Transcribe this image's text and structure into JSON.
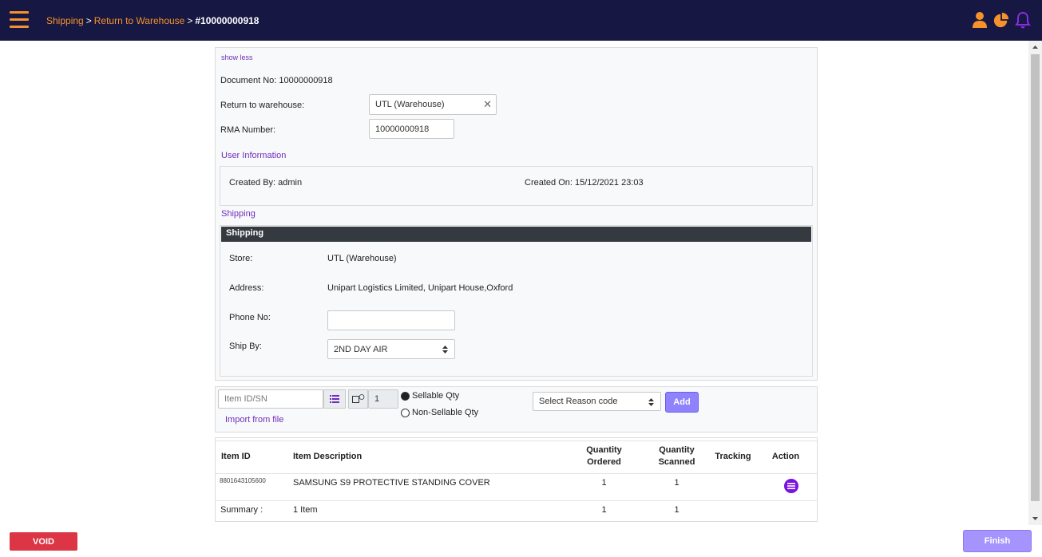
{
  "header": {
    "breadcrumb": {
      "level1": "Shipping",
      "sep1": ">",
      "level2": "Return to Warehouse",
      "sep2": ">",
      "current": "#10000000918"
    },
    "icons": [
      "hamburger-menu-icon",
      "user-icon",
      "pie-chart-icon",
      "bell-icon"
    ],
    "colors": {
      "bar": "#161743",
      "accent": "#f7922a",
      "bell": "#8b2be2"
    }
  },
  "details": {
    "show_less": "show less",
    "document_no": "Document No: 10000000918",
    "return_label": "Return to warehouse:",
    "return_value": "UTL (Warehouse)",
    "clear_glyph": "✕",
    "rma_label": "RMA Number:",
    "rma_value": "10000000918"
  },
  "user_info": {
    "section_title": "User Information",
    "created_by": "Created By: admin",
    "created_on": "Created On: 15/12/2021 23:03"
  },
  "shipping": {
    "section_title": "Shipping",
    "header": "Shipping",
    "store_label": "Store:",
    "store_value": "UTL (Warehouse)",
    "address_label": "Address:",
    "address_value": "Unipart Logistics Limited, Unipart House,Oxford",
    "phone_label": "Phone No:",
    "phone_value": "",
    "shipby_label": "Ship By:",
    "shipby_value": "2ND DAY AIR"
  },
  "add_item": {
    "item_placeholder": "Item ID/SN",
    "qty_value": "1",
    "import_link": "Import from file",
    "sellable": "Sellable Qty",
    "non_sellable": "Non-Sellable Qty",
    "reason_placeholder": "Select Reason code",
    "add_label": "Add"
  },
  "table": {
    "headers": {
      "item_id": "Item ID",
      "description": "Item Description",
      "qty_ordered_1": "Quantity",
      "qty_ordered_2": "Ordered",
      "qty_scanned_1": "Quantity",
      "qty_scanned_2": "Scanned",
      "tracking": "Tracking",
      "action": "Action"
    },
    "rows": [
      {
        "item_id": "8801643105600",
        "description": "SAMSUNG S9 PROTECTIVE STANDING COVER",
        "qty_ordered": "1",
        "qty_scanned": "1",
        "tracking": ""
      }
    ],
    "summary": {
      "label": "Summary :",
      "items": "1 Item",
      "qty_ordered": "1",
      "qty_scanned": "1"
    }
  },
  "footer": {
    "void_label": "VOID",
    "finish_label": "Finish"
  }
}
